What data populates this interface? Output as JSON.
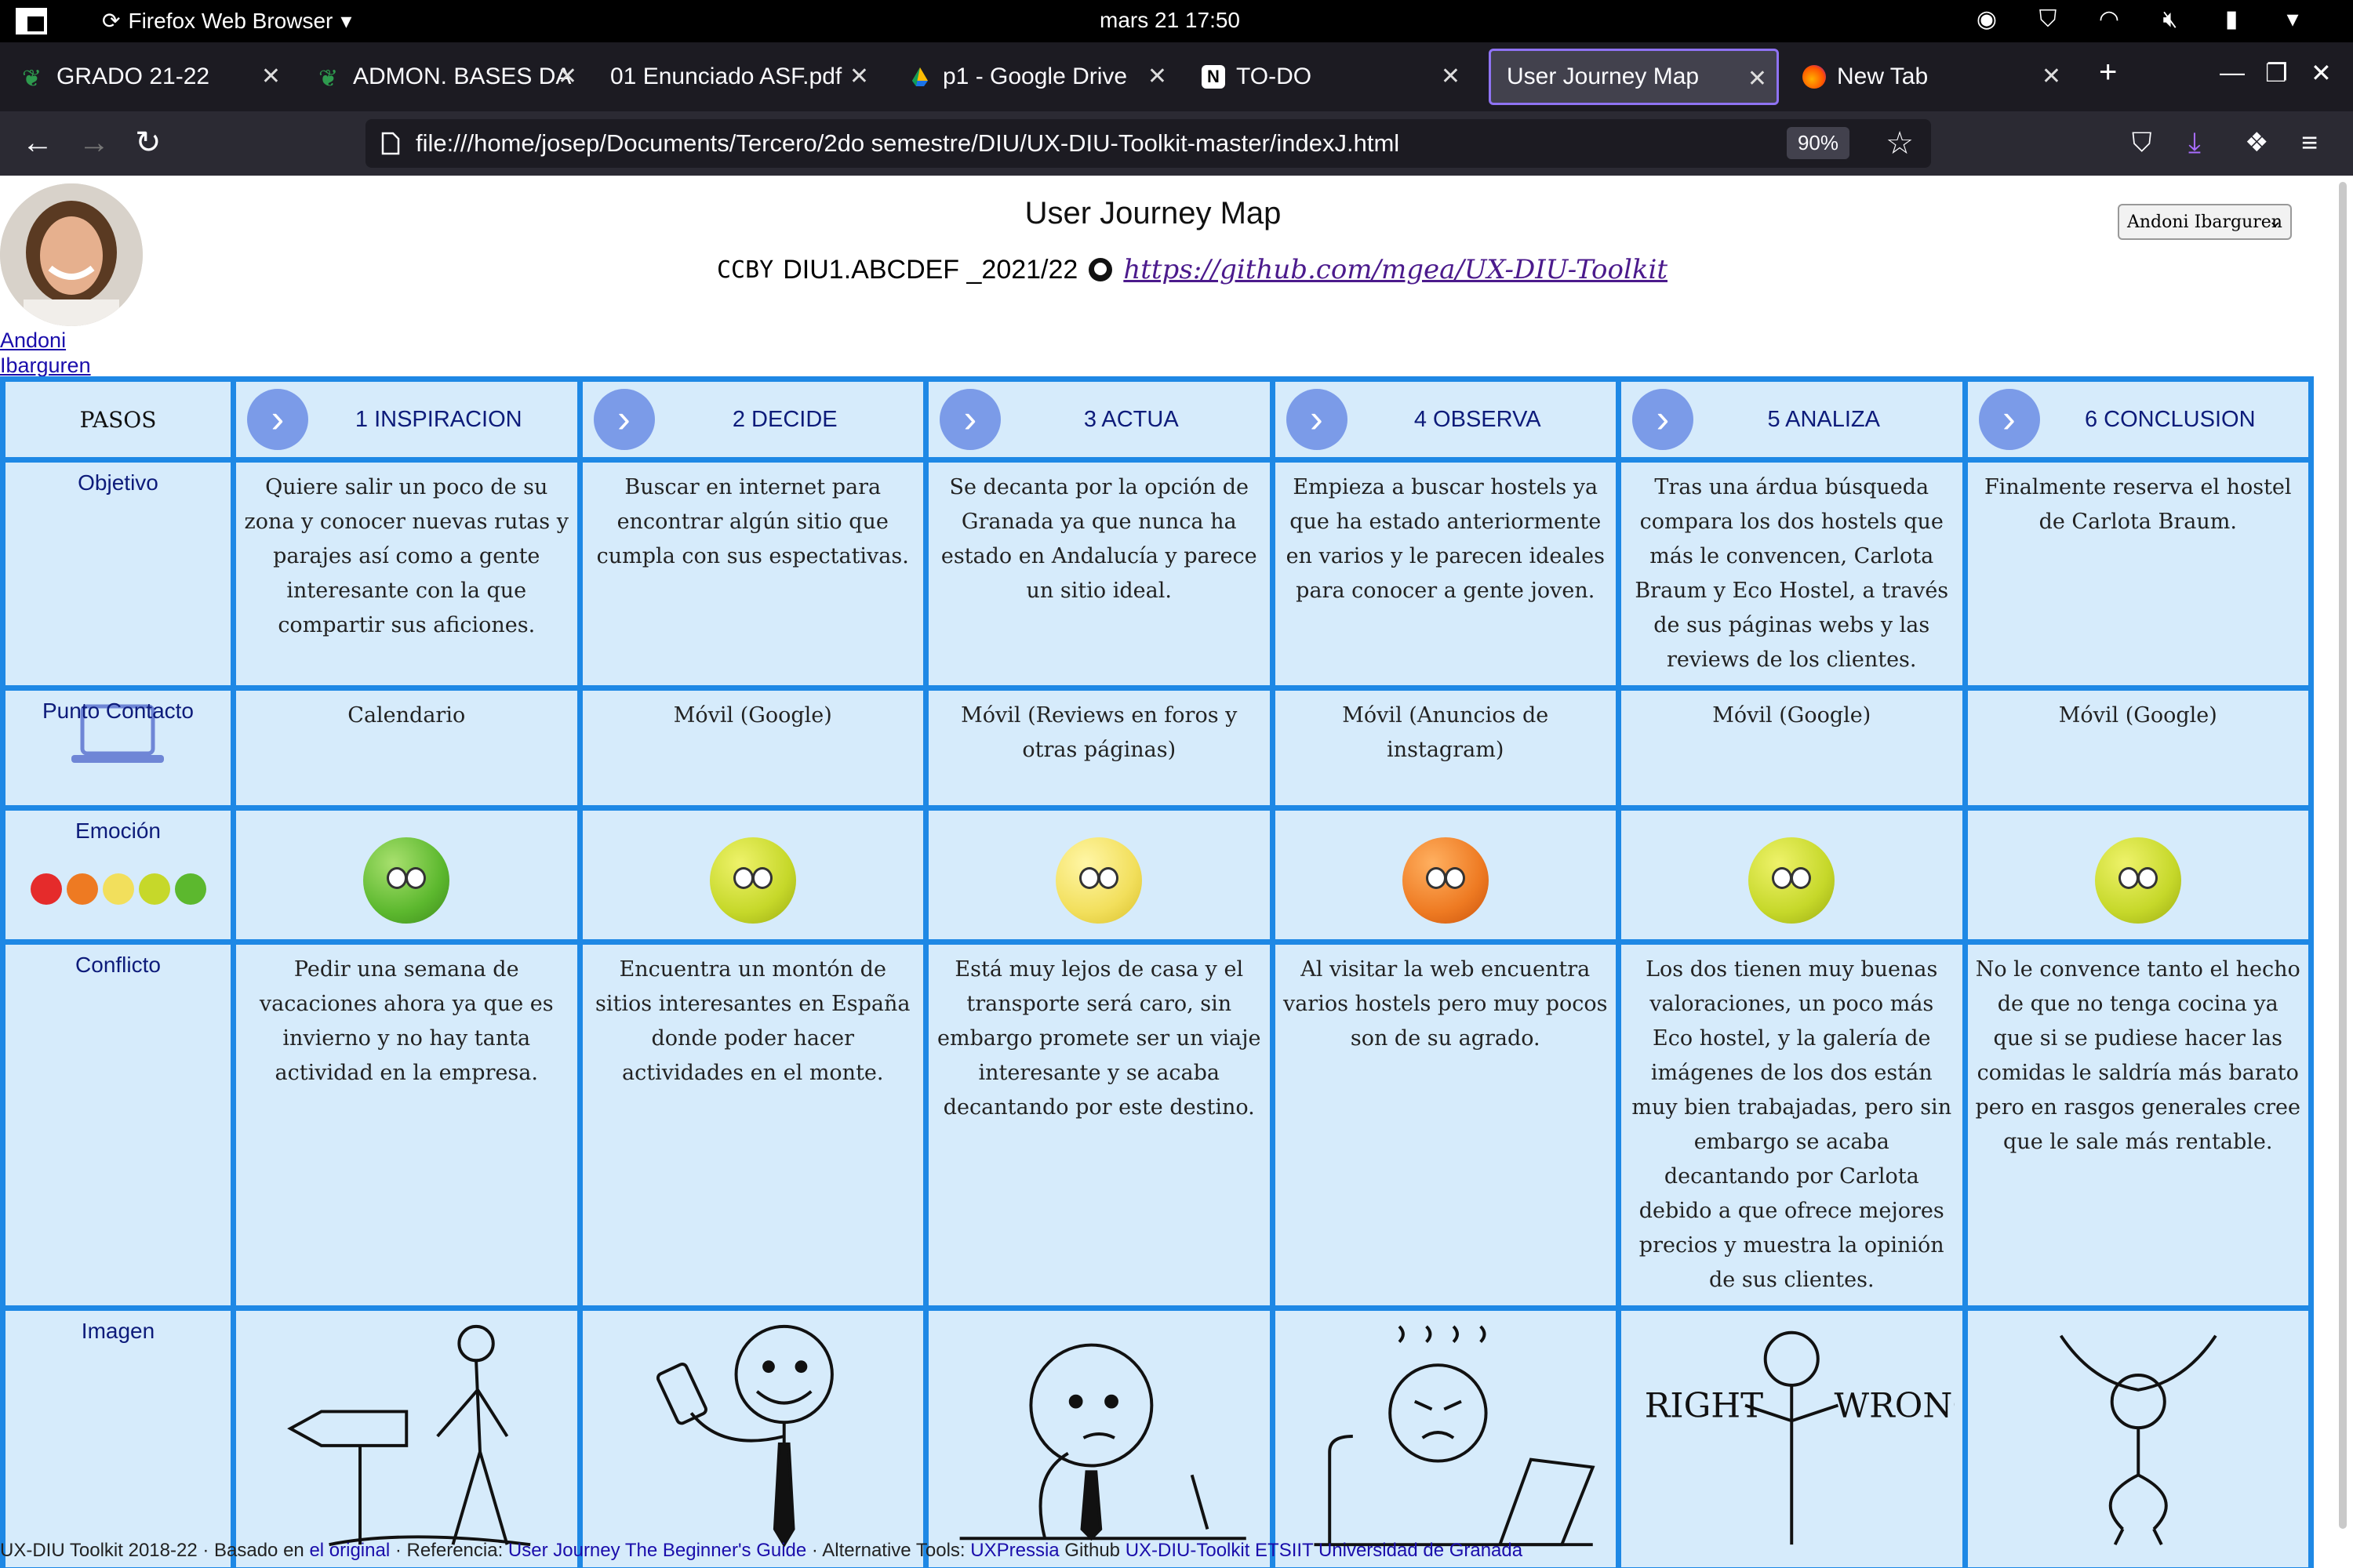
{
  "system": {
    "app_name": "Firefox Web Browser",
    "clock": "mars 21  17:50"
  },
  "tabs": [
    {
      "label": "GRADO 21-22",
      "favicon": "leaf-icon"
    },
    {
      "label": "ADMON. BASES DA",
      "favicon": "leaf-icon"
    },
    {
      "label": "01 Enunciado ASF.pdf",
      "favicon": ""
    },
    {
      "label": "p1 - Google Drive",
      "favicon": "drive-icon"
    },
    {
      "label": "TO-DO",
      "favicon": "notion-icon"
    },
    {
      "label": "User Journey Map",
      "favicon": "",
      "active": true
    },
    {
      "label": "New Tab",
      "favicon": "firefox-icon"
    }
  ],
  "navbar": {
    "url": "file:///home/josep/Documents/Tercero/2do semestre/DIU/UX-DIU-Toolkit-master/indexJ.html",
    "zoom": "90%"
  },
  "page": {
    "title": "User Journey Map",
    "cc_mark": "CCBY",
    "course": "DIU1.ABCDEF _2021/22",
    "repo_link": "https://github.com/mgea/UX-DIU-Toolkit",
    "persona_name": "Andoni Ibarguren",
    "persona_select": "Andoni Ibarguren"
  },
  "journey": {
    "row_labels": {
      "steps": "PASOS",
      "objective": "Objetivo",
      "touchpoint": "Punto Contacto",
      "emotion": "Emoción",
      "conflict": "Conflicto",
      "image": "Imagen"
    },
    "steps": [
      {
        "name": "1 INSPIRACION",
        "objective": "Quiere salir un poco de su zona y conocer nuevas rutas y parajes así como a gente interesante con la que compartir sus aficiones.",
        "touchpoint": "Calendario",
        "emotion": "happy",
        "conflict": "Pedir una semana de vacaciones ahora ya que es invierno y no hay tanta actividad en la empresa.",
        "image": "signpost-walker-sketch"
      },
      {
        "name": "2 DECIDE",
        "objective": "Buscar en internet para encontrar algún sitio que cumpla con sus espectativas.",
        "touchpoint": "Móvil (Google)",
        "emotion": "content",
        "conflict": "Encuentra un montón de sitios interesantes en España donde poder hacer actividades en el monte.",
        "image": "phone-smile-sketch"
      },
      {
        "name": "3 ACTUA",
        "objective": "Se decanta por la opción de Granada ya que nunca ha estado en Andalucía y parece un sitio ideal.",
        "touchpoint": "Móvil (Reviews en foros y otras páginas)",
        "emotion": "neutral",
        "conflict": "Está muy lejos de casa y el transporte será caro, sin embargo promete ser un viaje interesante y se acaba decantando por este destino.",
        "image": "thinking-desk-sketch"
      },
      {
        "name": "4 OBSERVA",
        "objective": "Empieza a buscar hostels ya que ha estado anteriormente en varios y le parecen ideales para conocer a gente joven.",
        "touchpoint": "Móvil (Anuncios de instagram)",
        "emotion": "angry",
        "conflict": "Al visitar la web encuentra varios hostels pero muy pocos son de su agrado.",
        "image": "frustrated-laptop-sketch"
      },
      {
        "name": "5 ANALIZA",
        "objective": "Tras una árdua búsqueda compara los dos hostels que más le convencen, Carlota Braum y Eco Hostel, a través de sus páginas webs y las reviews de los clientes.",
        "touchpoint": "Móvil (Google)",
        "emotion": "content",
        "conflict": "Los dos tienen muy buenas valoraciones, un poco más Eco hostel, y la galería de imágenes de los dos están muy bien trabajadas, pero sin embargo se acaba decantando por Carlota debido a que ofrece mejores precios y muestra la opinión de sus clientes.",
        "image": "right-wrong-sketch",
        "image_text_left": "RIGHT",
        "image_text_right": "WRONG"
      },
      {
        "name": "6 CONCLUSION",
        "objective": "Finalmente reserva el hostel de Carlota Braum.",
        "touchpoint": "Móvil (Google)",
        "emotion": "content",
        "conflict": "No le convence tanto el hecho de que no tenga cocina ya que si se pudiese hacer las comidas le saldría más barato pero en rasgos generales cree que le sale más rentable.",
        "image": "celebrating-sketch"
      }
    ],
    "emotion_colors": {
      "happy": "#5cb82e",
      "content": "#c6d82a",
      "neutral": "#f2df5c",
      "angry": "#ee7a22",
      "sad": "#e52b2b"
    },
    "emotion_scale": [
      "sad",
      "angry",
      "neutral",
      "content",
      "happy"
    ]
  },
  "footer": {
    "text1": "UX-DIU Toolkit 2018-22 · Basado en",
    "link1": "el original",
    "text2": " · Referencia:",
    "link2": "User Journey The Beginner's Guide",
    "text3": " · Alternative Tools:",
    "link3": "UXPressia",
    "text4": " Github",
    "link4": "UX-DIU-Toolkit ETSIIT Universidad de Granada"
  }
}
